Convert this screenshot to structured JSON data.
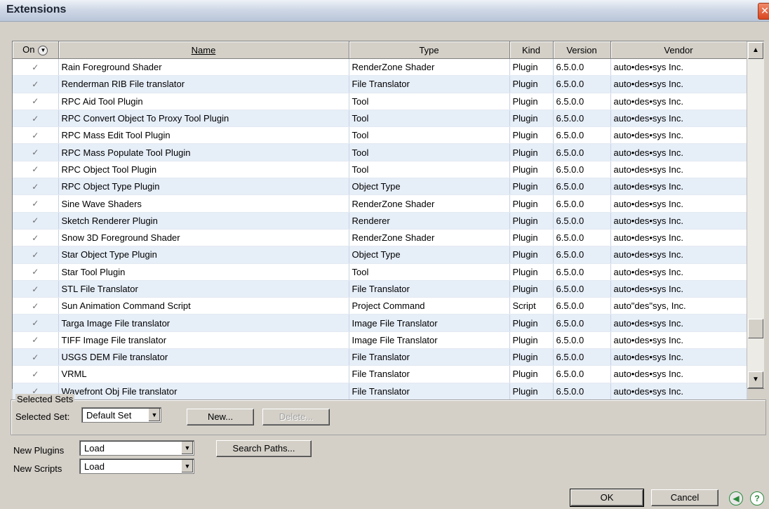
{
  "window": {
    "title": "Extensions"
  },
  "table": {
    "columns": [
      "On",
      "Name",
      "Type",
      "Kind",
      "Version",
      "Vendor"
    ],
    "rows": [
      {
        "name": "Rain Foreground Shader",
        "type": "RenderZone Shader",
        "kind": "Plugin",
        "version": "6.5.0.0",
        "vendor": "auto•des•sys Inc."
      },
      {
        "name": "Renderman RIB File translator",
        "type": "File Translator",
        "kind": "Plugin",
        "version": "6.5.0.0",
        "vendor": "auto•des•sys Inc."
      },
      {
        "name": "RPC Aid Tool Plugin",
        "type": "Tool",
        "kind": "Plugin",
        "version": "6.5.0.0",
        "vendor": "auto•des•sys Inc."
      },
      {
        "name": "RPC Convert Object To Proxy Tool Plugin",
        "type": "Tool",
        "kind": "Plugin",
        "version": "6.5.0.0",
        "vendor": "auto•des•sys Inc."
      },
      {
        "name": "RPC Mass Edit Tool Plugin",
        "type": "Tool",
        "kind": "Plugin",
        "version": "6.5.0.0",
        "vendor": "auto•des•sys Inc."
      },
      {
        "name": "RPC Mass Populate Tool Plugin",
        "type": "Tool",
        "kind": "Plugin",
        "version": "6.5.0.0",
        "vendor": "auto•des•sys Inc."
      },
      {
        "name": "RPC Object Tool Plugin",
        "type": "Tool",
        "kind": "Plugin",
        "version": "6.5.0.0",
        "vendor": "auto•des•sys Inc."
      },
      {
        "name": "RPC Object Type Plugin",
        "type": "Object Type",
        "kind": "Plugin",
        "version": "6.5.0.0",
        "vendor": "auto•des•sys Inc."
      },
      {
        "name": "Sine Wave Shaders",
        "type": "RenderZone Shader",
        "kind": "Plugin",
        "version": "6.5.0.0",
        "vendor": "auto•des•sys Inc."
      },
      {
        "name": "Sketch Renderer Plugin",
        "type": "Renderer",
        "kind": "Plugin",
        "version": "6.5.0.0",
        "vendor": "auto•des•sys Inc."
      },
      {
        "name": "Snow 3D Foreground Shader",
        "type": "RenderZone Shader",
        "kind": "Plugin",
        "version": "6.5.0.0",
        "vendor": "auto•des•sys Inc."
      },
      {
        "name": "Star Object Type Plugin",
        "type": "Object Type",
        "kind": "Plugin",
        "version": "6.5.0.0",
        "vendor": "auto•des•sys Inc."
      },
      {
        "name": "Star Tool Plugin",
        "type": "Tool",
        "kind": "Plugin",
        "version": "6.5.0.0",
        "vendor": "auto•des•sys Inc."
      },
      {
        "name": "STL File Translator",
        "type": "File Translator",
        "kind": "Plugin",
        "version": "6.5.0.0",
        "vendor": "auto•des•sys Inc."
      },
      {
        "name": "Sun Animation Command Script",
        "type": "Project Command",
        "kind": "Script",
        "version": "6.5.0.0",
        "vendor": "auto\"des\"sys, Inc."
      },
      {
        "name": "Targa Image File translator",
        "type": "Image File Translator",
        "kind": "Plugin",
        "version": "6.5.0.0",
        "vendor": "auto•des•sys Inc."
      },
      {
        "name": "TIFF Image File translator",
        "type": "Image File Translator",
        "kind": "Plugin",
        "version": "6.5.0.0",
        "vendor": "auto•des•sys Inc."
      },
      {
        "name": "USGS DEM File translator",
        "type": "File Translator",
        "kind": "Plugin",
        "version": "6.5.0.0",
        "vendor": "auto•des•sys Inc."
      },
      {
        "name": "VRML",
        "type": "File Translator",
        "kind": "Plugin",
        "version": "6.5.0.0",
        "vendor": "auto•des•sys Inc."
      },
      {
        "name": "Wavefront Obj File translator",
        "type": "File Translator",
        "kind": "Plugin",
        "version": "6.5.0.0",
        "vendor": "auto•des•sys Inc."
      }
    ]
  },
  "selected_sets": {
    "group_label": "Selected Sets",
    "set_label": "Selected Set:",
    "set_value": "Default Set",
    "new_label": "New...",
    "delete_label": "Delete..."
  },
  "options": {
    "new_plugins_label": "New Plugins",
    "new_plugins_value": "Load",
    "new_scripts_label": "New Scripts",
    "new_scripts_value": "Load",
    "search_paths_label": "Search Paths..."
  },
  "footer": {
    "ok_label": "OK",
    "cancel_label": "Cancel"
  },
  "icons": {
    "check": "checkmark-icon",
    "close": "close-icon",
    "back": "back-arrow-icon",
    "help": "help-icon",
    "dropdown": "chevron-down-icon"
  },
  "colors": {
    "row_alt": "#e6eef8",
    "dialog_bg": "#d4d0c8",
    "help_icon": "#2a8a3a",
    "close_button": "#d9451e"
  }
}
